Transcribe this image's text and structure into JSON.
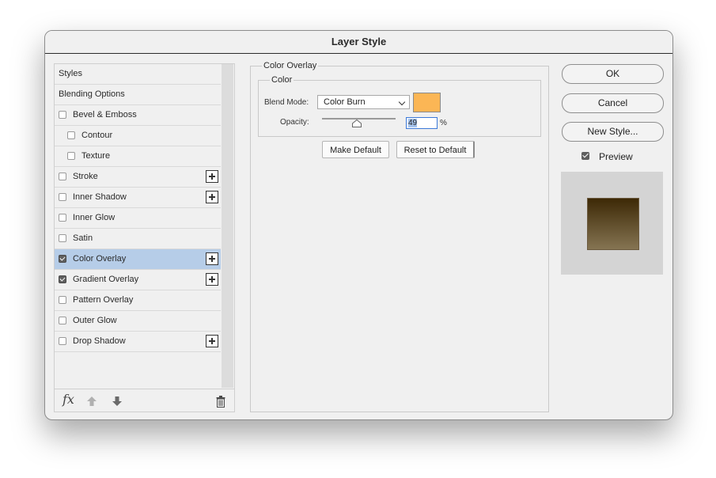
{
  "dialog": {
    "title": "Layer Style"
  },
  "styles_panel": {
    "items": [
      {
        "label": "Styles",
        "has_checkbox": false,
        "checked": false,
        "indent": 0,
        "has_add": false,
        "selected": false
      },
      {
        "label": "Blending Options",
        "has_checkbox": false,
        "checked": false,
        "indent": 0,
        "has_add": false,
        "selected": false
      },
      {
        "label": "Bevel & Emboss",
        "has_checkbox": true,
        "checked": false,
        "indent": 0,
        "has_add": false,
        "selected": false
      },
      {
        "label": "Contour",
        "has_checkbox": true,
        "checked": false,
        "indent": 1,
        "has_add": false,
        "selected": false
      },
      {
        "label": "Texture",
        "has_checkbox": true,
        "checked": false,
        "indent": 1,
        "has_add": false,
        "selected": false
      },
      {
        "label": "Stroke",
        "has_checkbox": true,
        "checked": false,
        "indent": 0,
        "has_add": true,
        "selected": false
      },
      {
        "label": "Inner Shadow",
        "has_checkbox": true,
        "checked": false,
        "indent": 0,
        "has_add": true,
        "selected": false
      },
      {
        "label": "Inner Glow",
        "has_checkbox": true,
        "checked": false,
        "indent": 0,
        "has_add": false,
        "selected": false
      },
      {
        "label": "Satin",
        "has_checkbox": true,
        "checked": false,
        "indent": 0,
        "has_add": false,
        "selected": false
      },
      {
        "label": "Color Overlay",
        "has_checkbox": true,
        "checked": true,
        "indent": 0,
        "has_add": true,
        "selected": true
      },
      {
        "label": "Gradient Overlay",
        "has_checkbox": true,
        "checked": true,
        "indent": 0,
        "has_add": true,
        "selected": false
      },
      {
        "label": "Pattern Overlay",
        "has_checkbox": true,
        "checked": false,
        "indent": 0,
        "has_add": false,
        "selected": false
      },
      {
        "label": "Outer Glow",
        "has_checkbox": true,
        "checked": false,
        "indent": 0,
        "has_add": false,
        "selected": false
      },
      {
        "label": "Drop Shadow",
        "has_checkbox": true,
        "checked": false,
        "indent": 0,
        "has_add": true,
        "selected": false
      }
    ],
    "fx_label": "fx",
    "icons": [
      "fx-icon",
      "move-up-icon",
      "move-down-icon",
      "trash-icon"
    ]
  },
  "color_overlay": {
    "section_title": "Color Overlay",
    "group_title": "Color",
    "blend_mode_label": "Blend Mode:",
    "blend_mode_value": "Color Burn",
    "color_swatch": "#fbb655",
    "opacity_label": "Opacity:",
    "opacity_value": "49",
    "opacity_unit": "%",
    "make_default_label": "Make Default",
    "reset_default_label": "Reset to Default"
  },
  "actions": {
    "ok_label": "OK",
    "cancel_label": "Cancel",
    "new_style_label": "New Style...",
    "preview_label": "Preview",
    "preview_checked": true
  },
  "colors": {
    "selection": "#b6cde8",
    "preview_gradient_top": "#3d2906",
    "preview_gradient_bottom": "#857452"
  }
}
